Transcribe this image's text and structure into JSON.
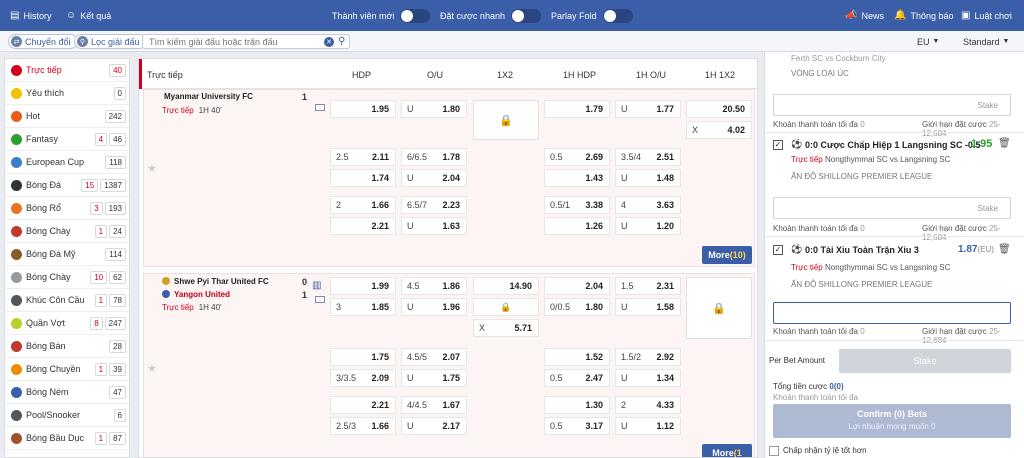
{
  "topbar": {
    "history": "History",
    "results": "Kết quả",
    "new_member": "Thành viên mới",
    "quick_bet": "Đặt cược nhanh",
    "parlay_fold": "Parlay Fold",
    "news": "News",
    "notices": "Thông báo",
    "rules": "Luật chơi"
  },
  "subbar": {
    "switch": "Chuyển đổi",
    "filter_league": "Lọc giải đấu",
    "search_placeholder": "Tìm kiếm giải đấu hoặc trận đấu",
    "odds_format": "EU",
    "view_mode": "Standard"
  },
  "sidebar": {
    "items": [
      {
        "label": "Trực tiếp",
        "counts": [
          "40"
        ],
        "red": [
          true
        ]
      },
      {
        "label": "Yêu thích",
        "counts": [
          "0"
        ],
        "red": [
          false
        ]
      },
      {
        "label": "Hot",
        "counts": [
          "242"
        ],
        "red": [
          false
        ]
      },
      {
        "label": "Fantasy",
        "counts": [
          "4",
          "46"
        ],
        "red": [
          true,
          false
        ]
      },
      {
        "label": "European Cup",
        "counts": [
          "118"
        ],
        "red": [
          false
        ]
      },
      {
        "label": "Bóng Đá",
        "counts": [
          "15",
          "1387"
        ],
        "red": [
          true,
          false
        ]
      },
      {
        "label": "Bóng Rổ",
        "counts": [
          "3",
          "193"
        ],
        "red": [
          true,
          false
        ]
      },
      {
        "label": "Bóng Chày",
        "counts": [
          "1",
          "24"
        ],
        "red": [
          true,
          false
        ]
      },
      {
        "label": "Bóng Đá Mỹ",
        "counts": [
          "114"
        ],
        "red": [
          false
        ]
      },
      {
        "label": "Bóng Chày",
        "counts": [
          "10",
          "62"
        ],
        "red": [
          true,
          false
        ]
      },
      {
        "label": "Khúc Côn Cầu",
        "counts": [
          "1",
          "78"
        ],
        "red": [
          true,
          false
        ]
      },
      {
        "label": "Quần Vợt",
        "counts": [
          "8",
          "247"
        ],
        "red": [
          true,
          false
        ]
      },
      {
        "label": "Bóng Bàn",
        "counts": [
          "28"
        ],
        "red": [
          false
        ]
      },
      {
        "label": "Bóng Chuyền",
        "counts": [
          "1",
          "39"
        ],
        "red": [
          true,
          false
        ]
      },
      {
        "label": "Bóng Ném",
        "counts": [
          "47"
        ],
        "red": [
          false
        ]
      },
      {
        "label": "Pool/Snooker",
        "counts": [
          "6"
        ],
        "red": [
          false
        ]
      },
      {
        "label": "Bóng Bầu Dục",
        "counts": [
          "1",
          "87"
        ],
        "red": [
          true,
          false
        ]
      }
    ]
  },
  "main": {
    "section_title": "Trực tiếp",
    "columns": [
      "HDP",
      "O/U",
      "1X2",
      "1H HDP",
      "1H O/U",
      "1H 1X2"
    ],
    "match1": {
      "home": "Myanmar University FC",
      "score_home": "1",
      "live": "Trực tiếp",
      "time": "1H 40'",
      "row1": {
        "hdp_v": "1.95",
        "ou_l": "U",
        "ou_v": "1.80",
        "h1hdp_v": "1.79",
        "h1ou_l": "U",
        "h1ou_v": "1.77",
        "h1x2_a": "20.50",
        "h1x2_xl": "X",
        "h1x2_x": "4.02"
      },
      "row2": {
        "hdp_l": "2.5",
        "hdp_a": "2.11",
        "hdp_b": "1.74",
        "ou_l": "6/6.5",
        "ou_a": "1.78",
        "ou_ul": "U",
        "ou_b": "2.04",
        "h1hdp_l": "0.5",
        "h1hdp_a": "2.69",
        "h1hdp_b": "1.43",
        "h1ou_l": "3.5/4",
        "h1ou_a": "2.51",
        "h1ou_ul": "U",
        "h1ou_b": "1.48"
      },
      "row3": {
        "hdp_l": "2",
        "hdp_a": "1.66",
        "hdp_b": "2.21",
        "ou_l": "6.5/7",
        "ou_a": "2.23",
        "ou_ul": "U",
        "ou_b": "1.63",
        "h1hdp_l": "0.5/1",
        "h1hdp_a": "3.38",
        "h1hdp_b": "1.26",
        "h1ou_l": "4",
        "h1ou_a": "3.63",
        "h1ou_ul": "U",
        "h1ou_b": "1.20"
      },
      "more": "More",
      "more_count": "(10)"
    },
    "match2": {
      "home": "Shwe Pyi Thar United FC",
      "away": "Yangon United",
      "score_home": "0",
      "score_away": "1",
      "live": "Trực tiếp",
      "time": "1H 40'",
      "row1": {
        "hdp_a": "1.99",
        "hdp_l": "3",
        "hdp_b": "1.85",
        "ou_l": "4.5",
        "ou_a": "1.86",
        "ou_ul": "U",
        "ou_b": "1.96",
        "x2_a": "14.90",
        "x2_xl": "X",
        "x2_x": "5.71",
        "h1hdp_a": "2.04",
        "h1hdp_l": "0/0.5",
        "h1hdp_b": "1.80",
        "h1ou_l": "1.5",
        "h1ou_a": "2.31",
        "h1ou_ul": "U",
        "h1ou_b": "1.58"
      },
      "row2": {
        "hdp_a": "1.75",
        "hdp_l": "3/3.5",
        "hdp_b": "2.09",
        "ou_l": "4.5/5",
        "ou_a": "2.07",
        "ou_ul": "U",
        "ou_b": "1.75",
        "h1hdp_a": "1.52",
        "h1hdp_l": "0.5",
        "h1hdp_b": "2.47",
        "h1ou_l": "1.5/2",
        "h1ou_a": "2.92",
        "h1ou_ul": "U",
        "h1ou_b": "1.34"
      },
      "row3": {
        "hdp_a": "2.21",
        "hdp_l": "2.5/3",
        "hdp_b": "1.66",
        "ou_l": "4/4.5",
        "ou_a": "1.67",
        "ou_ul": "U",
        "ou_b": "2.17",
        "h1hdp_a": "1.30",
        "h1hdp_l": "0.5",
        "h1hdp_b": "3.17",
        "h1ou_l": "2",
        "h1ou_a": "4.33",
        "h1ou_ul": "U",
        "h1ou_b": "1.12"
      },
      "more": "More",
      "more_count": "(1"
    }
  },
  "betslip": {
    "top_partial": "Ferth SC vs Cockburn City",
    "top_league": "VÒNG LOẠI ÚC",
    "stake_placeholder": "Stake",
    "min_payout_label": "Khoản thanh toán tối đa",
    "min_payout_value": "0",
    "bet_limit_label": "Giới hạn đặt cược",
    "bet_limit_value": "25-12,684",
    "bet1": {
      "title": "0:0 Cược Chấp Hiệp 1 Langsning SC -0.5",
      "odds": "1.95",
      "live": "Trực tiếp",
      "match": "Nongthymmai SC vs Langsning SC",
      "league": "ẤN ĐỘ SHILLONG PREMIER LEAGUE"
    },
    "bet2": {
      "title": "0:0 Tài Xỉu Toàn Trận Xỉu 3",
      "odds": "1.87",
      "odds_fmt": "(EU)",
      "live": "Trực tiếp",
      "match": "Nongthymmai SC vs Langsning SC",
      "league": "ẤN ĐỘ SHILLONG PREMIER LEAGUE"
    },
    "per_bet_amount": "Per Bet Amount",
    "stake_button": "Stake",
    "total_label": "Tổng tiền cược",
    "total_value": "0(0)",
    "total_payout_label": "Khoản thanh toán tối đa",
    "confirm_label": "Confirm (0) Bets",
    "confirm_sub": "Lợi nhuận mong muốn 0",
    "accept_odds": "Chấp nhận tỷ lệ tốt hơn"
  },
  "colors": {
    "header_blue": "#3b5ea8",
    "live_red": "#d0021b",
    "odds_green": "#2e9e2e"
  }
}
